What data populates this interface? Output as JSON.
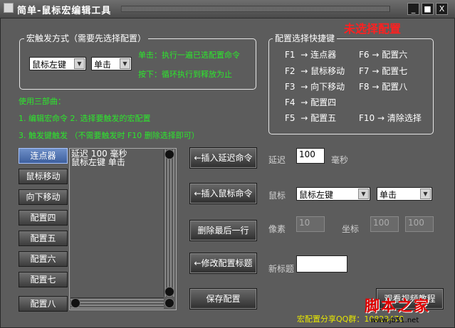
{
  "window": {
    "title": "简单-鼠标宏编辑工具",
    "min_label": "_",
    "max_label": "■",
    "close_label": "X"
  },
  "status": {
    "text": "未选择配置",
    "color": "#ff2020"
  },
  "trigger_group": {
    "legend": "宏触发方式（需要先选择配置）",
    "mouse_select": "鼠标左键",
    "click_select": "单击",
    "help_line1": "单击：执行一遍已选配置命令",
    "help_line2": "按下：循环执行到释放为止"
  },
  "usage": {
    "title": "使用三部曲：",
    "line1": "1. 编辑宏命令  2. 选择要触发的宏配置",
    "line2": "3. 触发键触发  （不需要触发时 F10 删除选择即可）"
  },
  "hotkeys": {
    "legend": "配置选择快捷键",
    "arrow": "→",
    "left": [
      {
        "key": "F1",
        "name": "连点器"
      },
      {
        "key": "F2",
        "name": "鼠标移动"
      },
      {
        "key": "F3",
        "name": "向下移动"
      },
      {
        "key": "F4",
        "name": "配置四"
      },
      {
        "key": "F5",
        "name": "配置五"
      }
    ],
    "right": [
      {
        "key": "F6",
        "name": "配置六"
      },
      {
        "key": "F7",
        "name": "配置七"
      },
      {
        "key": "F8",
        "name": "配置八"
      },
      {
        "key": "F10",
        "name": "清除选择"
      }
    ]
  },
  "configs": [
    "连点器",
    "鼠标移动",
    "向下移动",
    "配置四",
    "配置五",
    "配置六",
    "配置七",
    "配置八"
  ],
  "command_list": [
    "延迟 100 毫秒",
    "鼠标左键 单击"
  ],
  "actions": {
    "insert_delay": "←插入延迟命令",
    "insert_mouse": "←插入鼠标命令",
    "delete_last": "删除最后一行",
    "edit_title": "←修改配置标题",
    "save": "保存配置"
  },
  "delay": {
    "label": "延迟",
    "value": "100",
    "unit": "毫秒"
  },
  "mouse": {
    "label": "鼠标",
    "button_select": "鼠标左键",
    "action_select": "单击"
  },
  "pixel": {
    "label": "像素",
    "value": "10"
  },
  "coords": {
    "label": "坐标",
    "x": "100",
    "y": "100"
  },
  "new_title": {
    "label": "新标题",
    "value": ""
  },
  "footer": {
    "share_text": "宏配置分享QQ群：10823470",
    "video_button": "观看视频教程",
    "watermark": "脚本之家",
    "watermark_url": "www.jb51.net"
  }
}
